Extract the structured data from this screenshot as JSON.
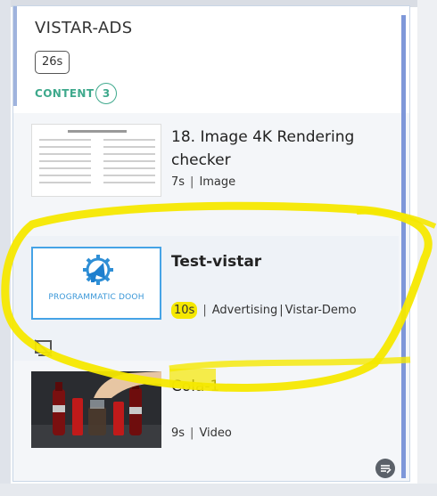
{
  "header": {
    "title": "VISTAR-ADS",
    "duration": "26s",
    "content_label": "CONTENT",
    "content_count": "3"
  },
  "items": [
    {
      "title": "18. Image 4K Rendering checker",
      "duration": "7s",
      "type": "Image",
      "thumbnail_icon": "document-preview-icon"
    },
    {
      "title": "Test-vistar",
      "duration": "10s",
      "type": "Advertising",
      "source": "Vistar-Demo",
      "thumbnail_text": "PROGRAMMATIC DOOH",
      "thumbnail_icon": "megaphone-gear-icon",
      "status_icon": "screen-off-icon"
    },
    {
      "title": "Cola-1",
      "duration": "9s",
      "type": "Video",
      "thumbnail_icon": "cola-bottles-photo"
    }
  ],
  "colors": {
    "accent_green": "#3ea98c",
    "accent_blue": "#45a3e6",
    "highlight_yellow": "#f5e800"
  },
  "fab_icon": "notes-icon"
}
